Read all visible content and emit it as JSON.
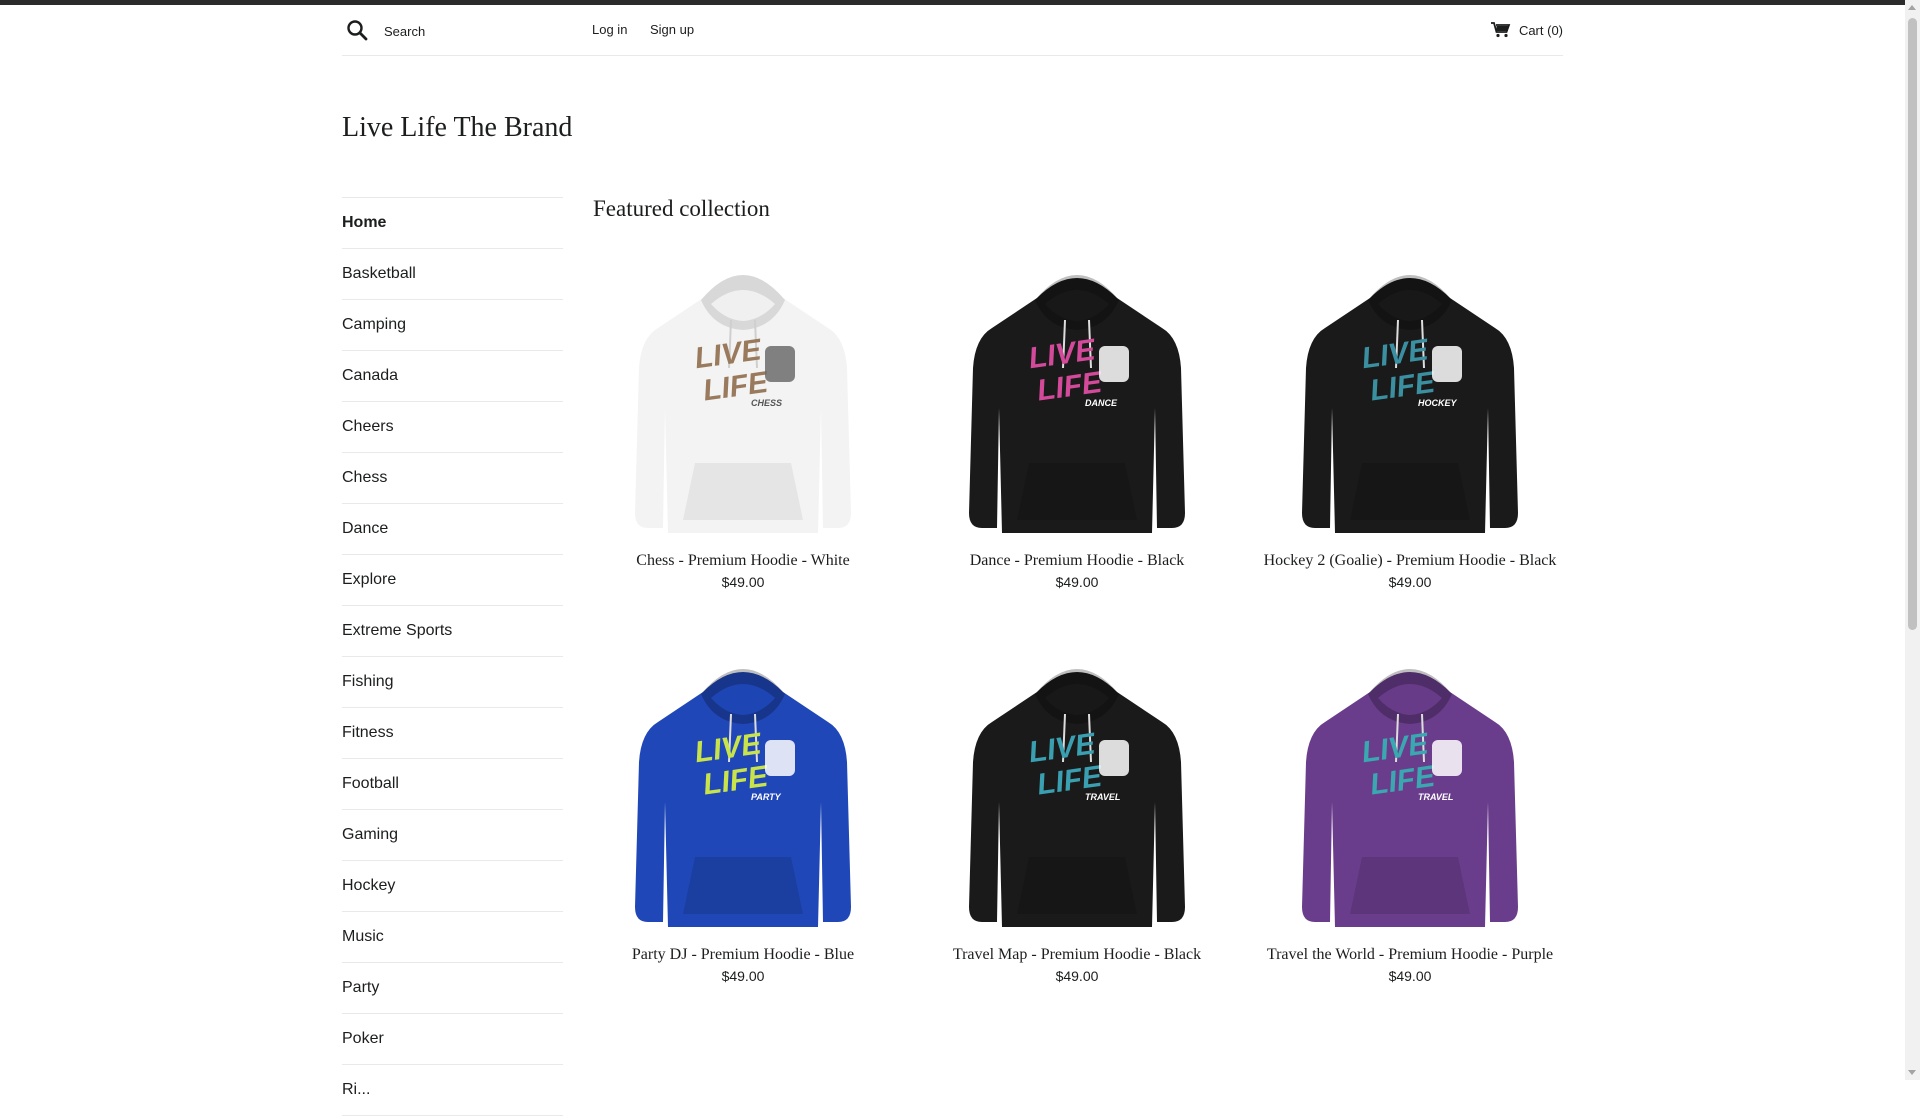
{
  "header": {
    "search_placeholder": "Search",
    "login_label": "Log in",
    "signup_label": "Sign up",
    "cart_label": "Cart (0)"
  },
  "brand": {
    "title": "Live Life The Brand"
  },
  "sidebar": {
    "items": [
      {
        "label": "Home",
        "active": true
      },
      {
        "label": "Basketball"
      },
      {
        "label": "Camping"
      },
      {
        "label": "Canada"
      },
      {
        "label": "Cheers"
      },
      {
        "label": "Chess"
      },
      {
        "label": "Dance"
      },
      {
        "label": "Explore"
      },
      {
        "label": "Extreme Sports"
      },
      {
        "label": "Fishing"
      },
      {
        "label": "Fitness"
      },
      {
        "label": "Football"
      },
      {
        "label": "Gaming"
      },
      {
        "label": "Hockey"
      },
      {
        "label": "Music"
      },
      {
        "label": "Party"
      },
      {
        "label": "Poker"
      },
      {
        "label": "Ri..."
      }
    ]
  },
  "main": {
    "title": "Featured collection",
    "products": [
      {
        "name": "Chess - Premium Hoodie - White",
        "price": "$49.00",
        "color": "#f3f3f3",
        "text_color": "#9a7a5c",
        "sub": "CHESS",
        "icon": "chess-pieces-icon"
      },
      {
        "name": "Dance - Premium Hoodie - Black",
        "price": "$49.00",
        "color": "#1a1a1a",
        "text_color": "#d34a9a",
        "sub": "DANCE",
        "icon": "dancer-icon"
      },
      {
        "name": "Hockey 2 (Goalie) - Premium Hoodie - Black",
        "price": "$49.00",
        "color": "#1a1a1a",
        "text_color": "#3a8fa0",
        "sub": "HOCKEY",
        "icon": "goalie-mask-icon"
      },
      {
        "name": "Party DJ - Premium Hoodie - Blue",
        "price": "$49.00",
        "color": "#1f47b8",
        "text_color": "#c9e44a",
        "sub": "PARTY",
        "icon": "dj-icon"
      },
      {
        "name": "Travel Map - Premium Hoodie - Black",
        "price": "$49.00",
        "color": "#1a1a1a",
        "text_color": "#3a9fb0",
        "sub": "TRAVEL",
        "icon": "map-icon"
      },
      {
        "name": "Travel the World - Premium Hoodie - Purple",
        "price": "$49.00",
        "color": "#6a3d8c",
        "text_color": "#3aa8b0",
        "sub": "TRAVEL",
        "icon": "world-icon"
      }
    ]
  }
}
